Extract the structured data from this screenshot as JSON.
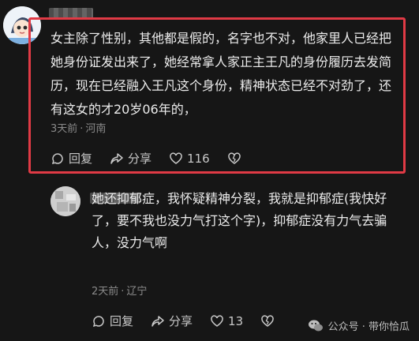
{
  "comments": [
    {
      "text": "女主除了性别，其他都是假的，名字也不对，他家里人已经把她身份证发出来了，她经常拿人家正主王凡的身份履历去发简历，现在已经融入王凡这个身份，精神状态已经不对劲了，还有这女的才20岁06年的，",
      "time": "3天前",
      "location": "河南",
      "reply_label": "回复",
      "share_label": "分享",
      "likes": "116"
    },
    {
      "text": "她还抑郁症，我怀疑精神分裂，我就是抑郁症(我快好了，要不我也没力气打这个字)，抑郁症没有力气去骗人，没力气啊",
      "time": "2天前",
      "location": "辽宁",
      "reply_label": "回复",
      "share_label": "分享",
      "likes": "13"
    }
  ],
  "watermark": {
    "text": "公众号 · 带你恰瓜"
  },
  "colors": {
    "highlight": "#e03a45",
    "background": "#161616"
  },
  "icons": [
    "reply-icon",
    "share-icon",
    "heart-icon",
    "dislike-icon",
    "wechat-icon"
  ]
}
